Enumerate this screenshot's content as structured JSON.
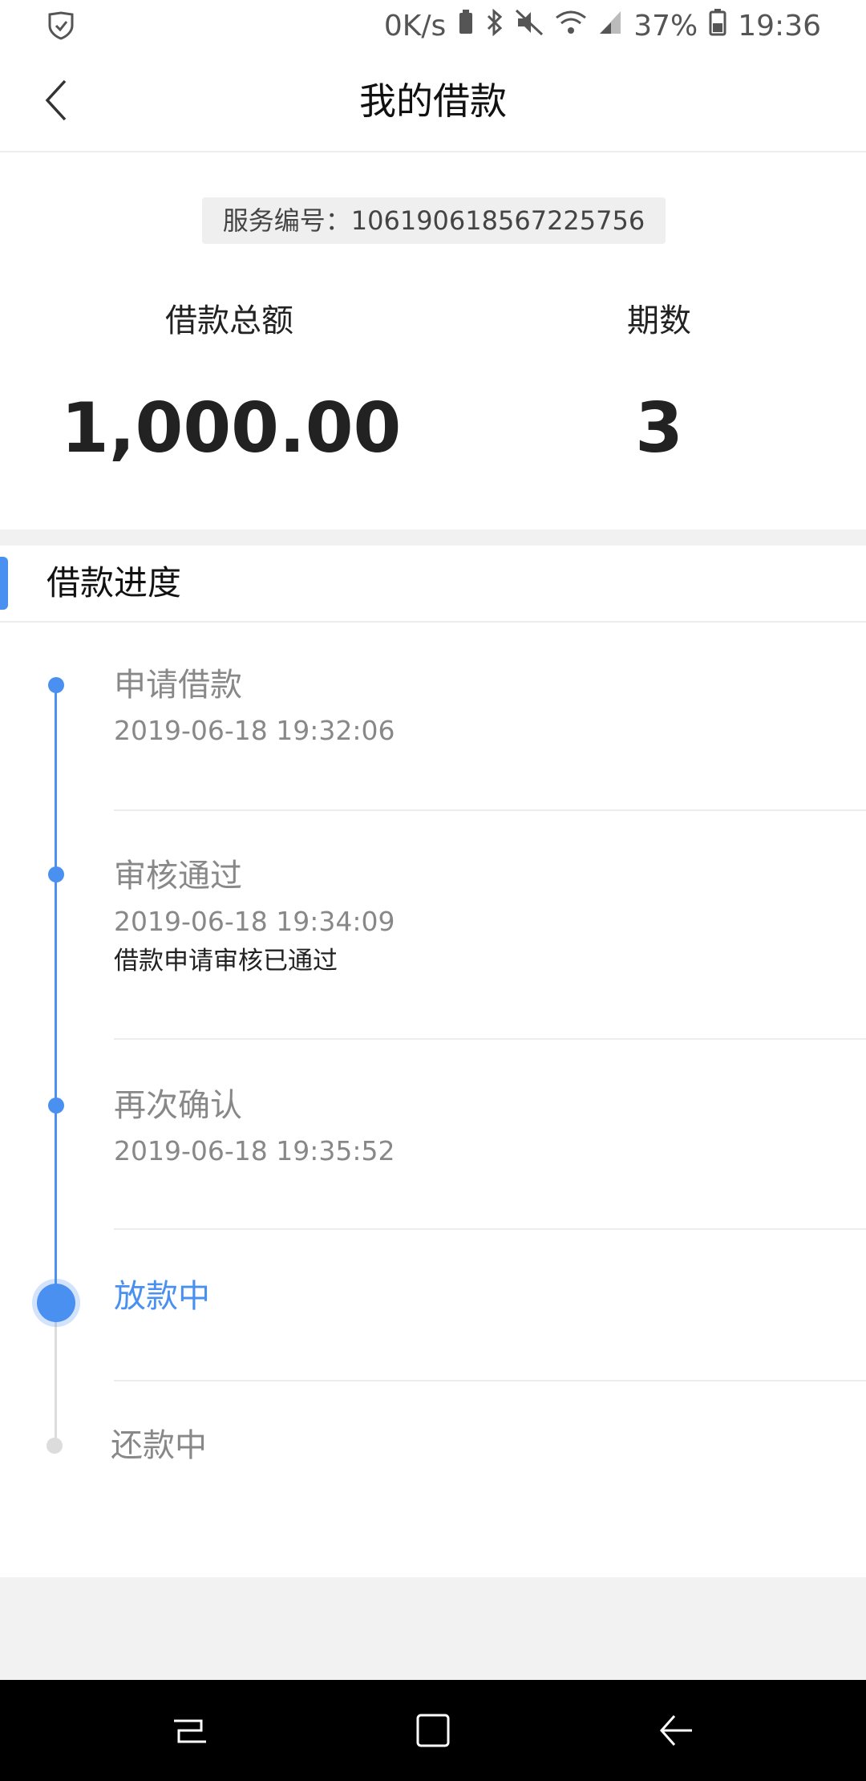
{
  "status_bar": {
    "speed": "0K/s",
    "battery": "37%",
    "time": "19:36"
  },
  "header": {
    "title": "我的借款"
  },
  "summary": {
    "service_no": "服务编号：106190618567225756",
    "total_label": "借款总额",
    "total_value": "1,000.00",
    "periods_label": "期数",
    "periods_value": "3"
  },
  "progress": {
    "section_title": "借款进度",
    "steps": [
      {
        "title": "申请借款",
        "time": "2019-06-18 19:32:06",
        "status": "done"
      },
      {
        "title": "审核通过",
        "time": "2019-06-18 19:34:09",
        "note": "借款申请审核已通过",
        "status": "done"
      },
      {
        "title": "再次确认",
        "time": "2019-06-18 19:35:52",
        "status": "done"
      },
      {
        "title": "放款中",
        "status": "current"
      },
      {
        "title": "还款中",
        "status": "pending"
      }
    ]
  },
  "colors": {
    "accent": "#4a90f0",
    "pending": "#dcdcdc"
  }
}
